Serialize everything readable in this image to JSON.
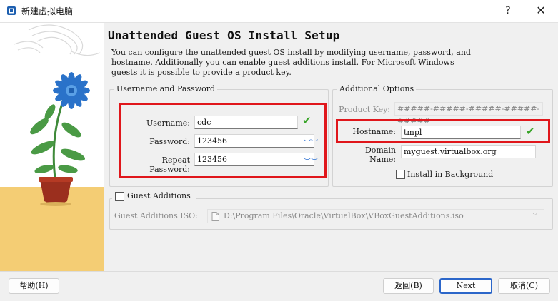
{
  "window": {
    "title": "新建虚拟电脑",
    "help": "?",
    "close": "✕"
  },
  "page": {
    "heading": "Unattended Guest OS Install Setup",
    "description": "You can configure the unattended guest OS install by modifying username, password, and\nhostname. Additionally you can enable guest additions install. For Microsoft Windows\nguests it is possible to provide a product key."
  },
  "user_group": {
    "title": "Username and Password",
    "username_label": "Username:",
    "username_value": "cdc",
    "password_label": "Password:",
    "password_value": "123456",
    "repeat_label": "Repeat Password:",
    "repeat_value": "123456"
  },
  "options_group": {
    "title": "Additional Options",
    "product_key_label": "Product Key:",
    "product_key_placeholder": "#####-#####-#####-#####-#####",
    "hostname_label": "Hostname:",
    "hostname_value": "tmpl",
    "domain_label": "Domain Name:",
    "domain_value": "myguest.virtualbox.org",
    "install_bg_label": "Install in Background"
  },
  "guest_additions": {
    "title": "Guest Additions",
    "iso_label": "Guest Additions ISO:",
    "iso_path": "D:\\Program Files\\Oracle\\VirtualBox\\VBoxGuestAdditions.iso"
  },
  "footer": {
    "help_label": "帮助(H)",
    "back_label": "返回(B)",
    "next_label": "Next",
    "cancel_label": "取消(C)"
  },
  "colors": {
    "accent": "#2b66c9",
    "highlight": "#e0161b",
    "valid": "#3aa52a"
  }
}
